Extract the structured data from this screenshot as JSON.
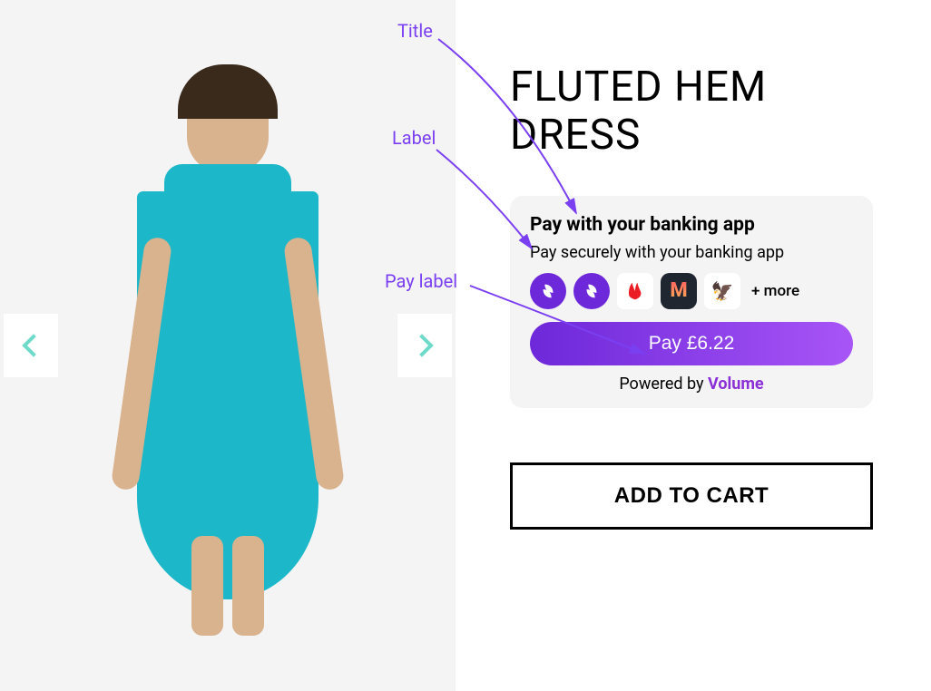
{
  "product": {
    "title": "FLUTED HEM DRESS"
  },
  "payCard": {
    "title": "Pay with your banking app",
    "label": "Pay securely with your banking app",
    "moreText": "+ more",
    "payButton": "Pay £6.22",
    "poweredPrefix": "Powered by ",
    "poweredBrand": "Volume"
  },
  "addToCart": "ADD TO CART",
  "annotations": {
    "title": "Title",
    "label": "Label",
    "payLabel": "Pay label"
  }
}
